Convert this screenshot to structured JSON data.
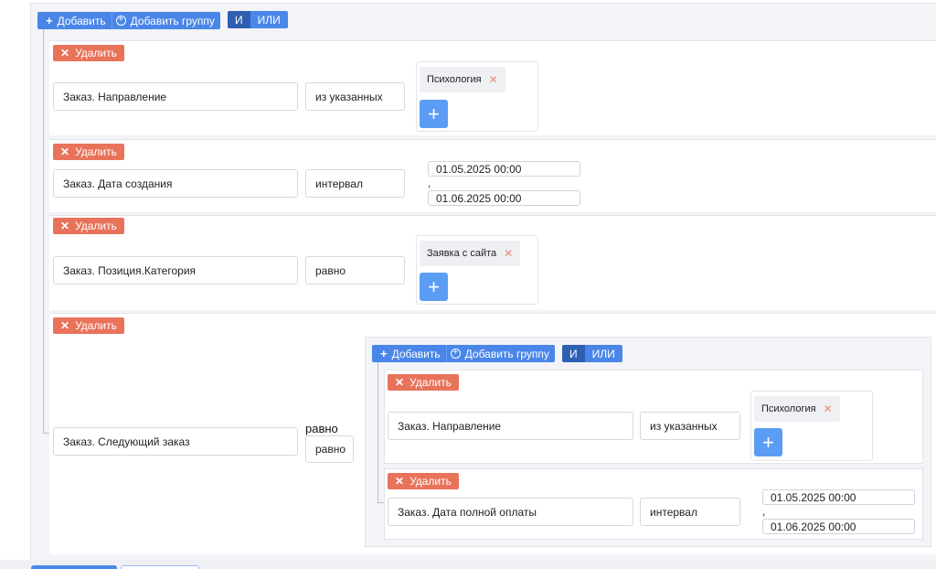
{
  "toolbar": {
    "add_label": "Добавить",
    "add_group_label": "Добавить группу",
    "and_label": "И",
    "or_label": "ИЛИ"
  },
  "delete_label": "Удалить",
  "rules": [
    {
      "field": "Заказ. Направление",
      "operator": "из указанных",
      "tags": [
        "Психология"
      ]
    },
    {
      "field": "Заказ. Дата создания",
      "operator": "интервал",
      "date_from": "01.05.2025 00:00",
      "separator": ",",
      "date_to": "01.06.2025 00:00"
    },
    {
      "field": "Заказ. Позиция.Категория",
      "operator": "равно",
      "tags": [
        "Заявка с сайта"
      ]
    },
    {
      "field": "Заказ. Следующий заказ",
      "operator_caption": "равно",
      "operator": "равно",
      "group": {
        "add_label": "Добавить",
        "add_group_label": "Добавить группу",
        "and_label": "И",
        "or_label": "ИЛИ",
        "rules": [
          {
            "field": "Заказ. Направление",
            "operator": "из указанных",
            "tags": [
              "Психология"
            ]
          },
          {
            "field": "Заказ. Дата полной оплаты",
            "operator": "интервал",
            "date_from": "01.05.2025 00:00",
            "separator": ",",
            "date_to": "01.06.2025 00:00"
          }
        ]
      }
    }
  ],
  "colors": {
    "primary": "#4a86e8",
    "primary_dark": "#2f5fb3",
    "danger": "#e8735a",
    "plus": "#5b9cf5"
  },
  "icons": {
    "add": "plus-icon",
    "add_group": "plus-circle-icon",
    "delete": "close-icon",
    "tag_remove": "close-icon"
  }
}
